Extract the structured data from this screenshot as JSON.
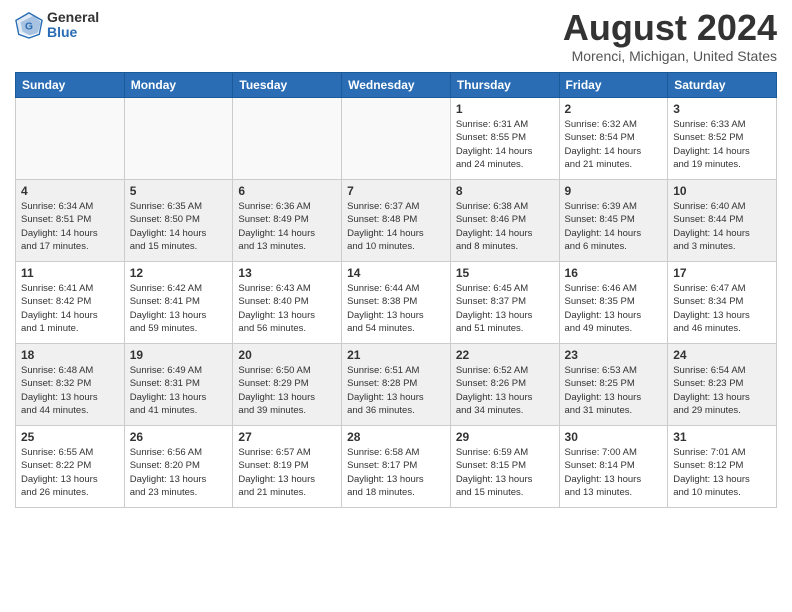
{
  "header": {
    "logo_general": "General",
    "logo_blue": "Blue",
    "month_title": "August 2024",
    "location": "Morenci, Michigan, United States"
  },
  "days_of_week": [
    "Sunday",
    "Monday",
    "Tuesday",
    "Wednesday",
    "Thursday",
    "Friday",
    "Saturday"
  ],
  "weeks": [
    [
      {
        "day": "",
        "info": ""
      },
      {
        "day": "",
        "info": ""
      },
      {
        "day": "",
        "info": ""
      },
      {
        "day": "",
        "info": ""
      },
      {
        "day": "1",
        "info": "Sunrise: 6:31 AM\nSunset: 8:55 PM\nDaylight: 14 hours\nand 24 minutes."
      },
      {
        "day": "2",
        "info": "Sunrise: 6:32 AM\nSunset: 8:54 PM\nDaylight: 14 hours\nand 21 minutes."
      },
      {
        "day": "3",
        "info": "Sunrise: 6:33 AM\nSunset: 8:52 PM\nDaylight: 14 hours\nand 19 minutes."
      }
    ],
    [
      {
        "day": "4",
        "info": "Sunrise: 6:34 AM\nSunset: 8:51 PM\nDaylight: 14 hours\nand 17 minutes."
      },
      {
        "day": "5",
        "info": "Sunrise: 6:35 AM\nSunset: 8:50 PM\nDaylight: 14 hours\nand 15 minutes."
      },
      {
        "day": "6",
        "info": "Sunrise: 6:36 AM\nSunset: 8:49 PM\nDaylight: 14 hours\nand 13 minutes."
      },
      {
        "day": "7",
        "info": "Sunrise: 6:37 AM\nSunset: 8:48 PM\nDaylight: 14 hours\nand 10 minutes."
      },
      {
        "day": "8",
        "info": "Sunrise: 6:38 AM\nSunset: 8:46 PM\nDaylight: 14 hours\nand 8 minutes."
      },
      {
        "day": "9",
        "info": "Sunrise: 6:39 AM\nSunset: 8:45 PM\nDaylight: 14 hours\nand 6 minutes."
      },
      {
        "day": "10",
        "info": "Sunrise: 6:40 AM\nSunset: 8:44 PM\nDaylight: 14 hours\nand 3 minutes."
      }
    ],
    [
      {
        "day": "11",
        "info": "Sunrise: 6:41 AM\nSunset: 8:42 PM\nDaylight: 14 hours\nand 1 minute."
      },
      {
        "day": "12",
        "info": "Sunrise: 6:42 AM\nSunset: 8:41 PM\nDaylight: 13 hours\nand 59 minutes."
      },
      {
        "day": "13",
        "info": "Sunrise: 6:43 AM\nSunset: 8:40 PM\nDaylight: 13 hours\nand 56 minutes."
      },
      {
        "day": "14",
        "info": "Sunrise: 6:44 AM\nSunset: 8:38 PM\nDaylight: 13 hours\nand 54 minutes."
      },
      {
        "day": "15",
        "info": "Sunrise: 6:45 AM\nSunset: 8:37 PM\nDaylight: 13 hours\nand 51 minutes."
      },
      {
        "day": "16",
        "info": "Sunrise: 6:46 AM\nSunset: 8:35 PM\nDaylight: 13 hours\nand 49 minutes."
      },
      {
        "day": "17",
        "info": "Sunrise: 6:47 AM\nSunset: 8:34 PM\nDaylight: 13 hours\nand 46 minutes."
      }
    ],
    [
      {
        "day": "18",
        "info": "Sunrise: 6:48 AM\nSunset: 8:32 PM\nDaylight: 13 hours\nand 44 minutes."
      },
      {
        "day": "19",
        "info": "Sunrise: 6:49 AM\nSunset: 8:31 PM\nDaylight: 13 hours\nand 41 minutes."
      },
      {
        "day": "20",
        "info": "Sunrise: 6:50 AM\nSunset: 8:29 PM\nDaylight: 13 hours\nand 39 minutes."
      },
      {
        "day": "21",
        "info": "Sunrise: 6:51 AM\nSunset: 8:28 PM\nDaylight: 13 hours\nand 36 minutes."
      },
      {
        "day": "22",
        "info": "Sunrise: 6:52 AM\nSunset: 8:26 PM\nDaylight: 13 hours\nand 34 minutes."
      },
      {
        "day": "23",
        "info": "Sunrise: 6:53 AM\nSunset: 8:25 PM\nDaylight: 13 hours\nand 31 minutes."
      },
      {
        "day": "24",
        "info": "Sunrise: 6:54 AM\nSunset: 8:23 PM\nDaylight: 13 hours\nand 29 minutes."
      }
    ],
    [
      {
        "day": "25",
        "info": "Sunrise: 6:55 AM\nSunset: 8:22 PM\nDaylight: 13 hours\nand 26 minutes."
      },
      {
        "day": "26",
        "info": "Sunrise: 6:56 AM\nSunset: 8:20 PM\nDaylight: 13 hours\nand 23 minutes."
      },
      {
        "day": "27",
        "info": "Sunrise: 6:57 AM\nSunset: 8:19 PM\nDaylight: 13 hours\nand 21 minutes."
      },
      {
        "day": "28",
        "info": "Sunrise: 6:58 AM\nSunset: 8:17 PM\nDaylight: 13 hours\nand 18 minutes."
      },
      {
        "day": "29",
        "info": "Sunrise: 6:59 AM\nSunset: 8:15 PM\nDaylight: 13 hours\nand 15 minutes."
      },
      {
        "day": "30",
        "info": "Sunrise: 7:00 AM\nSunset: 8:14 PM\nDaylight: 13 hours\nand 13 minutes."
      },
      {
        "day": "31",
        "info": "Sunrise: 7:01 AM\nSunset: 8:12 PM\nDaylight: 13 hours\nand 10 minutes."
      }
    ]
  ]
}
